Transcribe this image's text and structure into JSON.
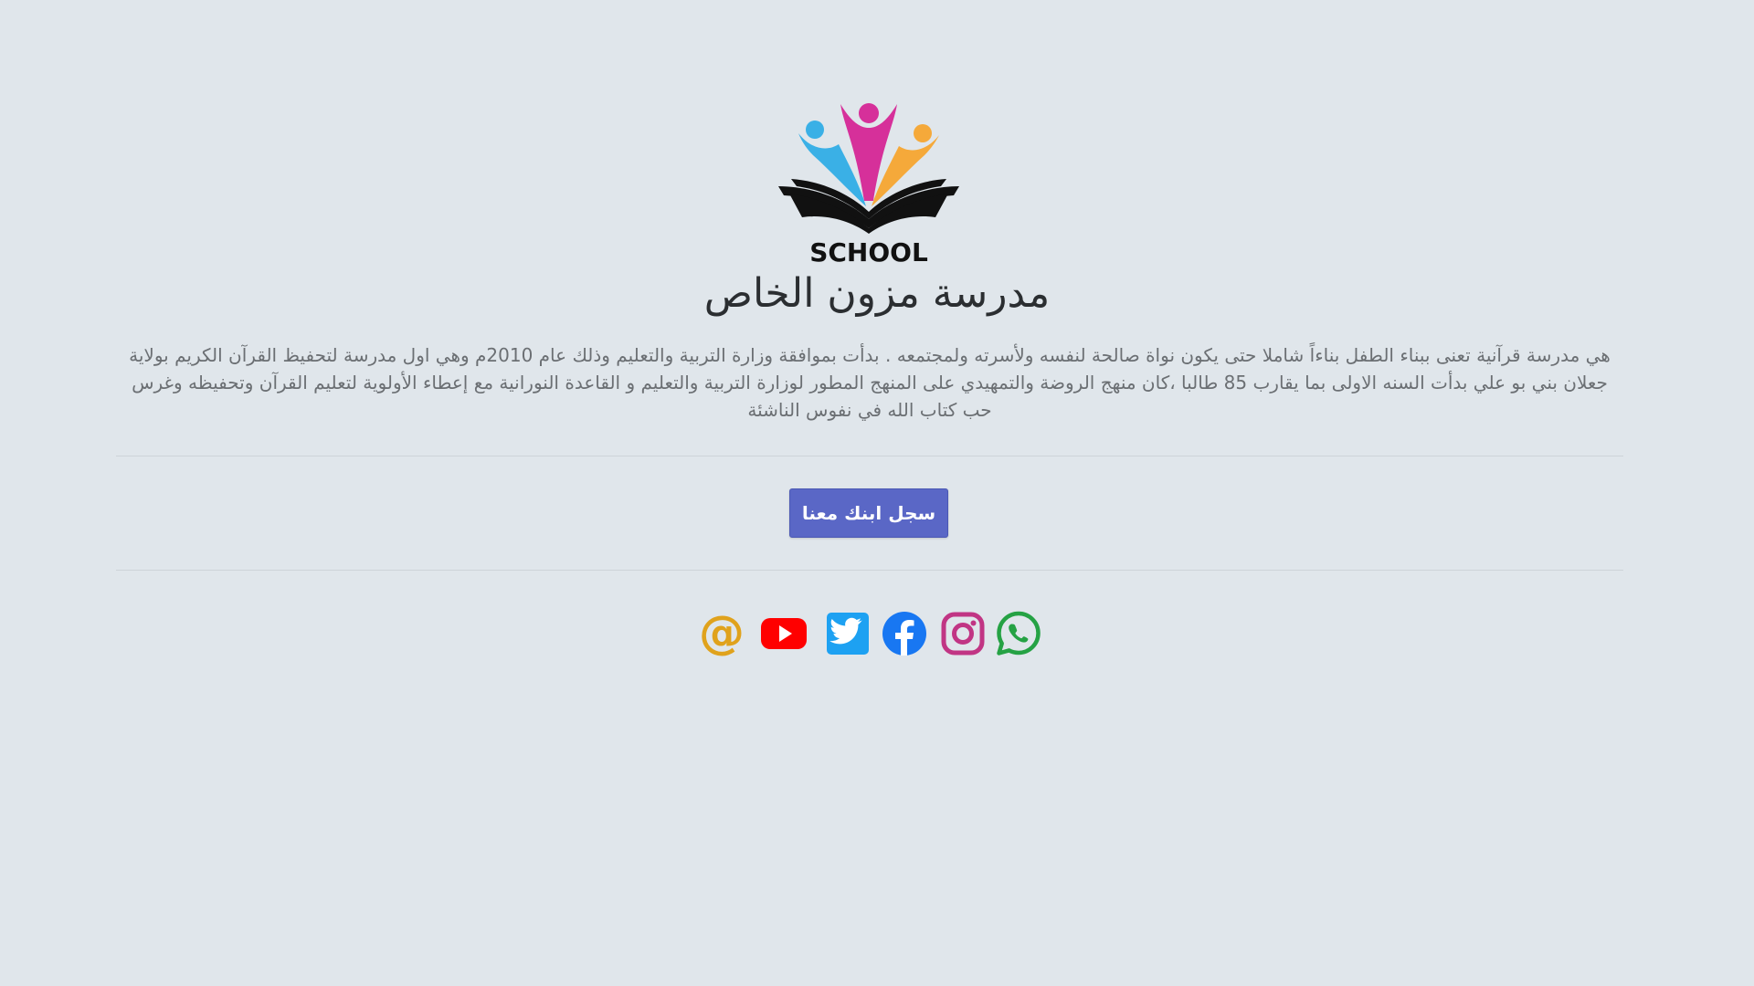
{
  "logo": {
    "text": "SCHOOL",
    "colors": {
      "pink": "#d6309a",
      "blue": "#3ab0e6",
      "orange": "#f5a93a",
      "book": "#111111"
    }
  },
  "title": "مدرسة مزون الخاص",
  "description": "هي مدرسة قرآنية تعنى ببناء الطفل بناءاً شاملا حتى يكون نواة صالحة لنفسه ولأسرته ولمجتمعه . بدأت بموافقة وزارة التربية والتعليم وذلك عام 2010م وهي اول مدرسة لتحفيظ القرآن الكريم بولاية جعلان بني بو علي بدأت السنه الاولى بما يقارب 85 طالبا ،كان منهج الروضة والتمهيدي على المنهج المطور لوزارة التربية والتعليم و القاعدة النورانية مع إعطاء الأولوية لتعليم القرآن وتحفيظه وغرس حب كتاب الله في نفوس الناشئة",
  "cta": {
    "label": "سجل ابنك معنا",
    "color": "#5a67c6"
  },
  "social": [
    {
      "name": "email-icon",
      "color": "#e0a21c"
    },
    {
      "name": "youtube-icon",
      "color": "#ff0000"
    },
    {
      "name": "twitter-icon",
      "color": "#1da1f2"
    },
    {
      "name": "facebook-icon",
      "color": "#1877f2"
    },
    {
      "name": "instagram-icon",
      "color": "#c13584"
    },
    {
      "name": "whatsapp-icon",
      "color": "#25a244"
    }
  ]
}
